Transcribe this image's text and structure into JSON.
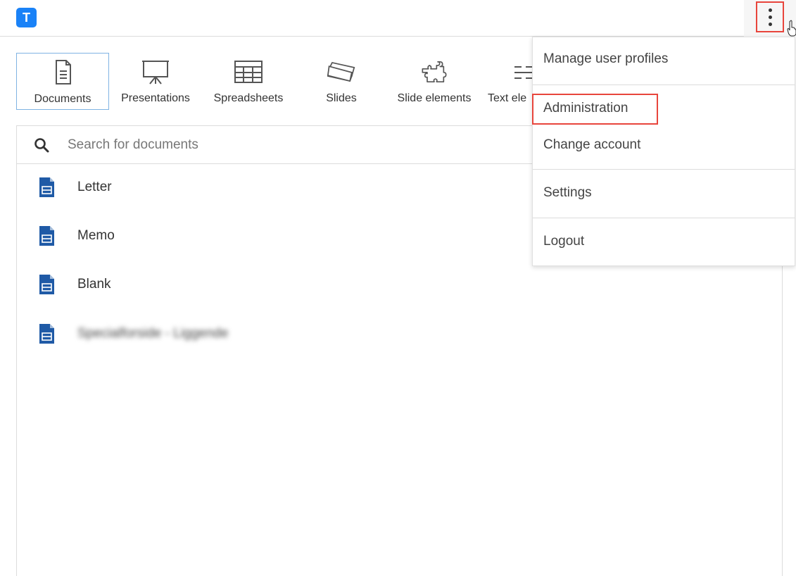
{
  "app": {
    "logo_letter": "T",
    "accent": "#1a82f7"
  },
  "tabs": [
    {
      "label": "Documents",
      "icon": "document-icon",
      "active": true
    },
    {
      "label": "Presentations",
      "icon": "presentation-icon",
      "active": false
    },
    {
      "label": "Spreadsheets",
      "icon": "spreadsheet-icon",
      "active": false
    },
    {
      "label": "Slides",
      "icon": "slides-icon",
      "active": false
    },
    {
      "label": "Slide elements",
      "icon": "puzzle-icon",
      "active": false
    },
    {
      "label": "Text ele",
      "icon": "text-elements-icon",
      "active": false
    }
  ],
  "search": {
    "placeholder": "Search for documents",
    "value": ""
  },
  "documents": [
    {
      "label": "Letter",
      "blurred": false
    },
    {
      "label": "Memo",
      "blurred": false
    },
    {
      "label": "Blank",
      "blurred": false
    },
    {
      "label": "Specialforside - Liggende",
      "blurred": true
    }
  ],
  "menu": {
    "items": [
      {
        "label": "Manage user profiles"
      },
      {
        "label": "Administration"
      },
      {
        "label": "Change account"
      },
      {
        "label": "Settings"
      },
      {
        "label": "Logout"
      }
    ]
  },
  "colors": {
    "highlight": "#e8453c",
    "doc_icon": "#1f5aa6"
  }
}
